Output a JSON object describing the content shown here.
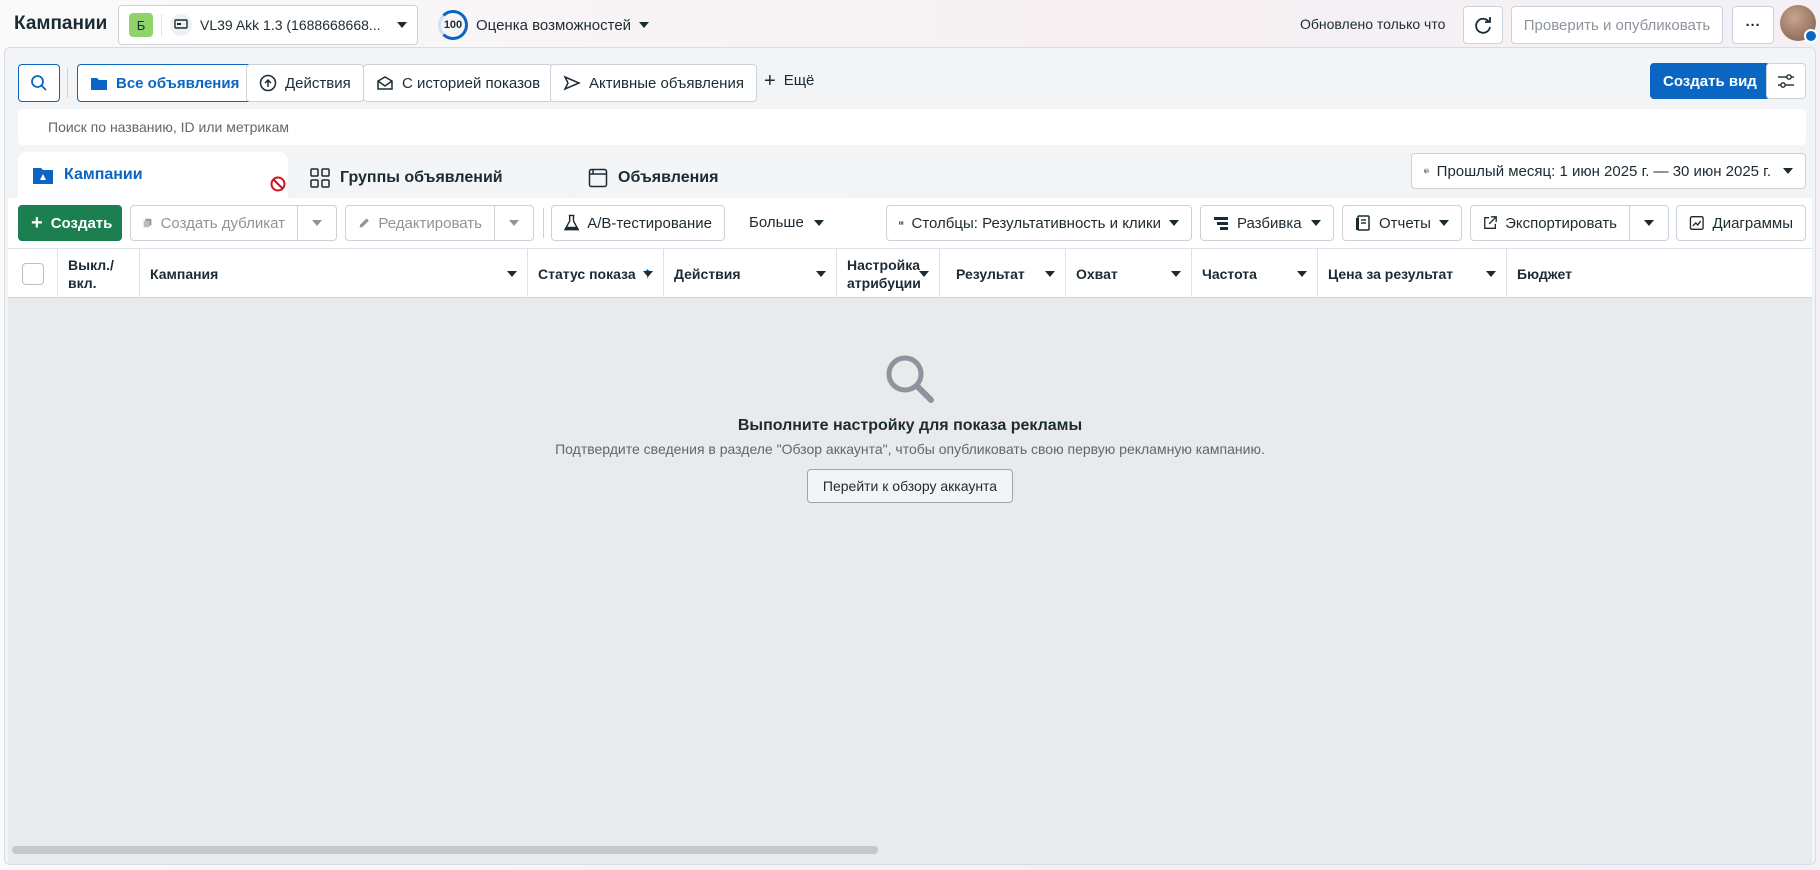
{
  "topbar": {
    "title": "Кампании",
    "account_badge": "Б",
    "account_name": "VL39 Akk 1.3 (1688668668...",
    "score_value": "100",
    "score_label": "Оценка возможностей",
    "updated": "Обновлено только что",
    "publish_label": "Проверить и опубликовать",
    "more_label": "···"
  },
  "filters": {
    "all_ads": "Все объявления",
    "actions": "Действия",
    "history": "С историей показов",
    "active": "Активные объявления",
    "more": "Ещё",
    "create_view": "Создать вид"
  },
  "search": {
    "placeholder": "Поиск по названию, ID или метрикам"
  },
  "tabs": {
    "campaigns": "Кампании",
    "adsets": "Группы объявлений",
    "ads": "Объявления",
    "date_range": "Прошлый месяц: 1 июн 2025 г. — 30 июн 2025 г."
  },
  "toolbar": {
    "create": "Создать",
    "duplicate": "Создать дубликат",
    "edit": "Редактировать",
    "ab_test": "A/B-тестирование",
    "more": "Больше",
    "columns": "Столбцы: Результативность и клики",
    "breakdown": "Разбивка",
    "reports": "Отчеты",
    "export": "Экспортировать",
    "charts": "Диаграммы"
  },
  "table": {
    "headers": {
      "toggle_1": "Выкл./",
      "toggle_2": "вкл.",
      "campaign": "Кампания",
      "delivery": "Статус показа",
      "actions": "Действия",
      "attribution_1": "Настройка",
      "attribution_2": "атрибуции",
      "result": "Результат",
      "reach": "Охват",
      "frequency": "Частота",
      "cost_per_result": "Цена за результат",
      "budget": "Бюджет"
    }
  },
  "empty_state": {
    "title": "Выполните настройку для показа рекламы",
    "subtitle": "Подтвердите сведения в разделе \"Обзор аккаунта\", чтобы опубликовать свою первую рекламную кампанию.",
    "button": "Перейти к обзору аккаунта"
  },
  "colors": {
    "accent": "#0a66c2",
    "create": "#1b7f4f",
    "badge": "#8fd36a"
  }
}
